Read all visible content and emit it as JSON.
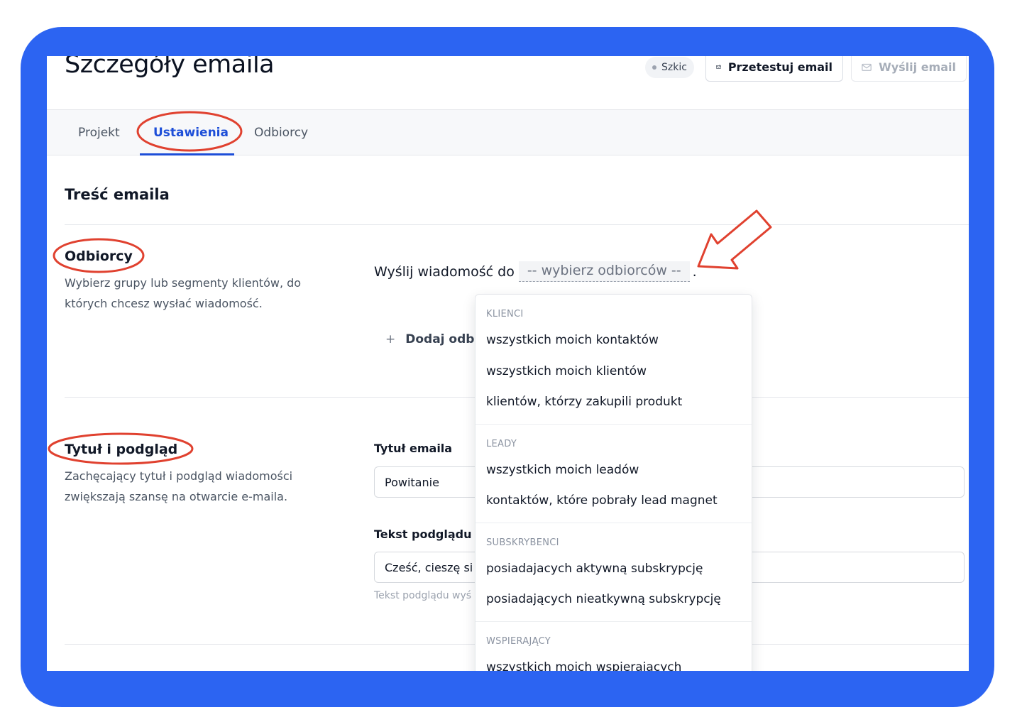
{
  "header": {
    "title": "Szczegóły emaila",
    "status_badge": "Szkic",
    "test_button": "Przetestuj email",
    "send_button": "Wyślij email"
  },
  "tabs": [
    {
      "label": "Projekt"
    },
    {
      "label": "Ustawienia",
      "active": true
    },
    {
      "label": "Odbiorcy"
    }
  ],
  "content": {
    "section_heading": "Treść emaila",
    "recipients": {
      "title": "Odbiorcy",
      "description": "Wybierz grupy lub segmenty klientów, do których chcesz wysłać wiadomość.",
      "send_to_label": "Wyślij wiadomość do",
      "select_placeholder": "-- wybierz odbiorców --",
      "period": ".",
      "add_recipient": "Dodaj odbio"
    },
    "title_preview": {
      "title": "Tytuł i podgląd",
      "description": "Zachęcający tytuł i podgląd wiadomości zwiększają szansę na otwarcie e-maila.",
      "email_title_label": "Tytuł emaila",
      "email_title_value": "Powitanie",
      "preview_label": "Tekst podglądu",
      "preview_value": "Cześć, cieszę si",
      "preview_hint": "Tekst podglądu wyś"
    }
  },
  "dropdown": {
    "groups": [
      {
        "title": "KLIENCI",
        "items": [
          "wszystkich moich kontaktów",
          "wszystkich moich klientów",
          "klientów, którzy zakupili produkt"
        ]
      },
      {
        "title": "LEADY",
        "items": [
          "wszystkich moich leadów",
          "kontaktów, które pobrały lead magnet"
        ]
      },
      {
        "title": "SUBSKRYBENCI",
        "items": [
          "posiadajacych aktywną subskrypcję",
          "posiadających nieatkywną subskrypcję"
        ]
      },
      {
        "title": "WSPIERAJĄCY",
        "items": [
          "wszystkich moich wspierających"
        ]
      }
    ]
  },
  "colors": {
    "frame": "#2c64f2",
    "accent": "#1d4ed8",
    "annotation": "#e0412f"
  },
  "icons": [
    "status-dot-icon",
    "test-email-icon",
    "send-email-icon",
    "plus-icon",
    "arrow-annotation-icon"
  ]
}
